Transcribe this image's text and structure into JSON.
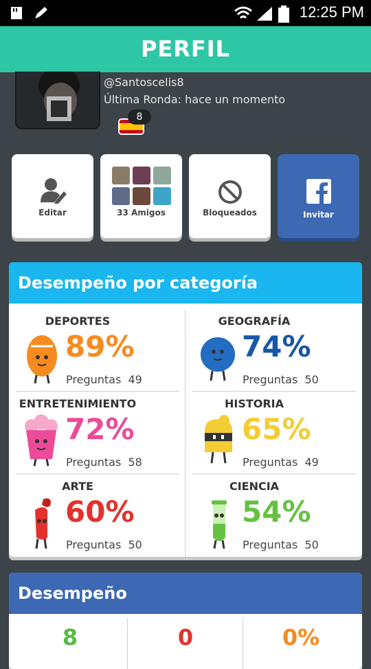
{
  "status_bar": {
    "time": "12:25 PM"
  },
  "app_bar": {
    "title": "PERFIL"
  },
  "profile": {
    "username": "@Santoscelis8",
    "last_round": "Última Ronda: hace un momento",
    "level": "8",
    "flag": "spain-flag"
  },
  "actions": [
    {
      "label": "Editar",
      "icon": "edit-user-icon"
    },
    {
      "label": "33 Amigos",
      "icon": "friends-grid"
    },
    {
      "label": "Bloqueados",
      "icon": "block-icon"
    },
    {
      "label": "Invitar",
      "icon": "facebook-icon"
    }
  ],
  "category_card": {
    "title": "Desempeño por categoría",
    "color": "#1ab6ef",
    "questions_label": "Preguntas",
    "categories": [
      {
        "name": "DEPORTES",
        "percent": "89%",
        "questions": "49",
        "color": "#f68b1f"
      },
      {
        "name": "GEOGRAFÍA",
        "percent": "74%",
        "questions": "50",
        "color": "#1756a9"
      },
      {
        "name": "ENTRETENIMIENTO",
        "percent": "72%",
        "questions": "58",
        "color": "#ec4b98"
      },
      {
        "name": "HISTORIA",
        "percent": "65%",
        "questions": "49",
        "color": "#f4cd35"
      },
      {
        "name": "ARTE",
        "percent": "60%",
        "questions": "50",
        "color": "#e4312b"
      },
      {
        "name": "CIENCIA",
        "percent": "54%",
        "questions": "50",
        "color": "#66c143"
      }
    ]
  },
  "performance_card": {
    "title": "Desempeño",
    "color": "#3d68b4",
    "stats": [
      {
        "value": "8",
        "color": "#5aba47"
      },
      {
        "value": "0",
        "color": "#e4312b"
      },
      {
        "value": "0%",
        "color": "#f68b1f"
      }
    ]
  }
}
